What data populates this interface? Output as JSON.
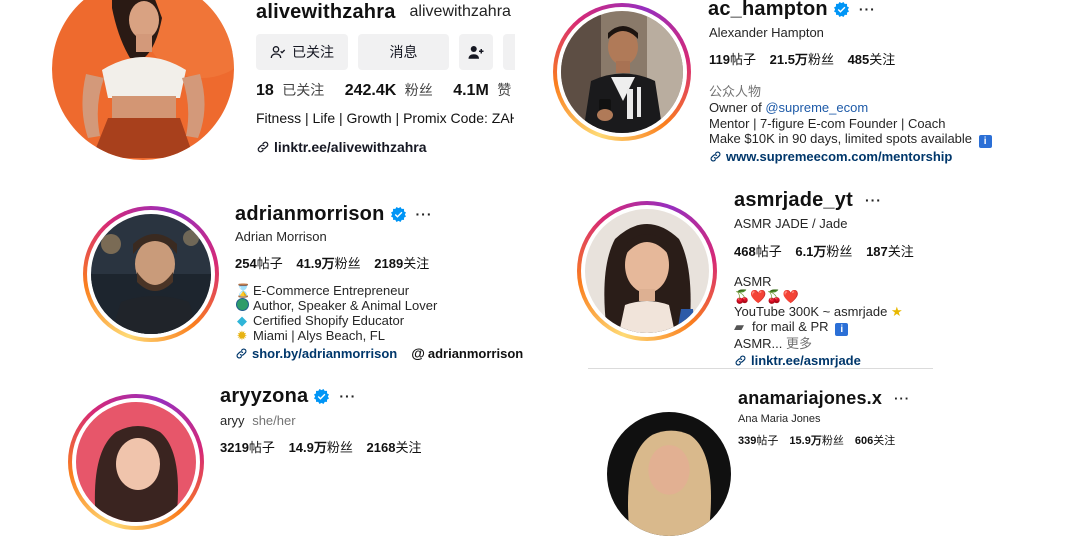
{
  "zahra": {
    "username": "alivewithzahra",
    "handle": "alivewithzahra",
    "follow_button": "已关注",
    "message_button": "消息",
    "following_count": "18",
    "following_label": "已关注",
    "followers_count": "242.4K",
    "followers_label": "粉丝",
    "likes_count": "4.1M",
    "likes_label": "赞",
    "bio": "Fitness | Life | Growth | Promix Code: ZAH",
    "link": "linktr.ee/alivewithzahra"
  },
  "hampton": {
    "username": "ac_hampton",
    "name": "Alexander Hampton",
    "posts_count": "119",
    "posts_label": "帖子",
    "followers_count": "21.5万",
    "followers_label": "粉丝",
    "following_count": "485",
    "following_label": "关注",
    "category": "公众人物",
    "bio_line1_prefix": "Owner of ",
    "bio_line1_link": "@supreme_ecom",
    "bio_line2": "Mentor | 7-figure E-com Founder | Coach",
    "bio_line3": "Make $10K in 90 days, limited spots available",
    "link": "www.supremeecom.com/mentorship"
  },
  "adrian": {
    "username": "adrianmorrison",
    "name": "Adrian Morrison",
    "posts_count": "254",
    "posts_label": "帖子",
    "followers_count": "41.9万",
    "followers_label": "粉丝",
    "following_count": "2189",
    "following_label": "关注",
    "bio_lines": [
      "E-Commerce Entrepreneur",
      "Author, Speaker & Animal Lover",
      "Certified Shopify Educator",
      "Miami | Alys Beach, FL"
    ],
    "link": "shor.by/adrianmorrison",
    "threads_handle": "adrianmorrison"
  },
  "jade": {
    "username": "asmrjade_yt",
    "name": "ASMR JADE / Jade",
    "posts_count": "468",
    "posts_label": "帖子",
    "followers_count": "6.1万",
    "followers_label": "粉丝",
    "following_count": "187",
    "following_label": "关注",
    "bio_line1": "ASMR",
    "bio_line2": "🍒❤️🍒❤️",
    "bio_line3": "YouTube 300K ~ asmrjade",
    "bio_line4": "for mail & PR",
    "bio_more_text": "ASMR... ",
    "bio_more_label": "更多",
    "link": "linktr.ee/asmrjade"
  },
  "aryy": {
    "username": "aryyzona",
    "name": "aryy",
    "pronouns": "she/her",
    "posts_count": "3219",
    "posts_label": "帖子",
    "followers_count": "14.9万",
    "followers_label": "粉丝",
    "following_count": "2168",
    "following_label": "关注"
  },
  "ana": {
    "username": "anamariajones.x",
    "name": "Ana Maria Jones",
    "posts_count": "339",
    "posts_label": "帖子",
    "followers_count": "15.9万",
    "followers_label": "粉丝",
    "following_count": "606",
    "following_label": "关注"
  },
  "colors": {
    "verified_blue": "#0095f6",
    "link_blue": "#00376b",
    "ring_gradient": [
      "#feda75",
      "#fa7e1e",
      "#d62976",
      "#962fbf"
    ]
  }
}
